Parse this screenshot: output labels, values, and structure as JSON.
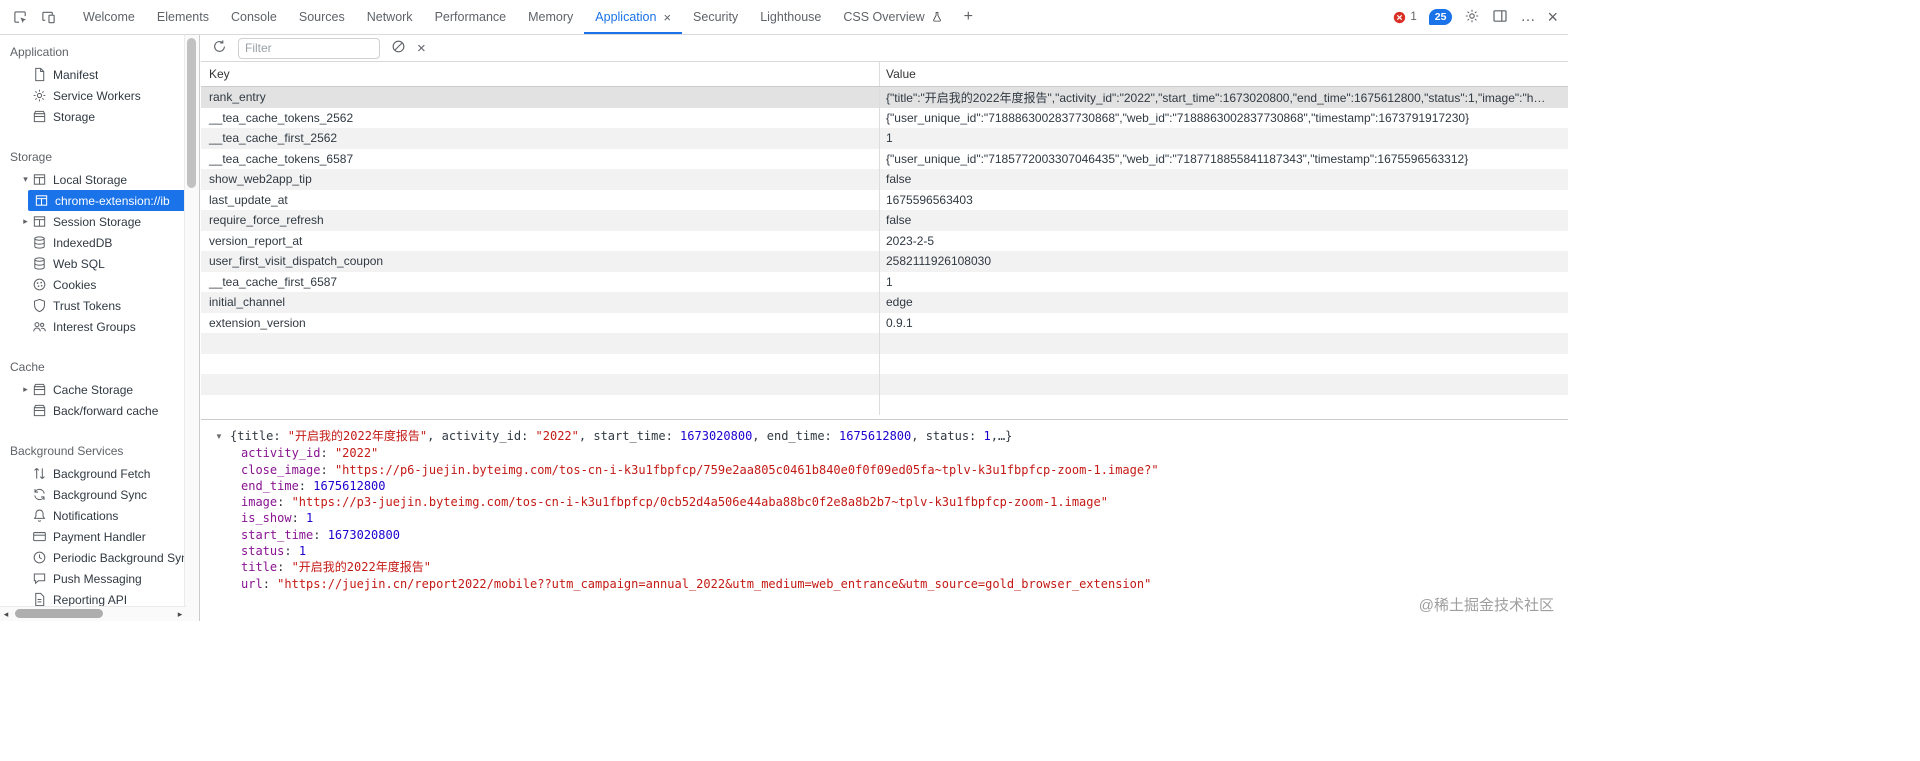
{
  "glyphs": {
    "expanded": "▾",
    "collapsed": "▸",
    "preview_triangle": "▼",
    "dots": "…",
    "close": "×",
    "plus": "+",
    "scroll_left": "◂",
    "scroll_right": "▸"
  },
  "tab_bar": {
    "tabs": [
      {
        "label": "Welcome"
      },
      {
        "label": "Elements"
      },
      {
        "label": "Console"
      },
      {
        "label": "Sources"
      },
      {
        "label": "Network"
      },
      {
        "label": "Performance"
      },
      {
        "label": "Memory"
      },
      {
        "label": "Application",
        "active": true,
        "closable": true
      },
      {
        "label": "Security"
      },
      {
        "label": "Lighthouse"
      },
      {
        "label": "CSS Overview",
        "flagged": true
      }
    ],
    "error_count": "1",
    "issue_count": "25"
  },
  "sidebar": {
    "sections": [
      {
        "title": "Application",
        "items": [
          {
            "label": "Manifest",
            "icon": "manifest-file-icon"
          },
          {
            "label": "Service Workers",
            "icon": "service-worker-icon"
          },
          {
            "label": "Storage",
            "icon": "storage-box-icon"
          }
        ]
      },
      {
        "title": "Storage",
        "items": [
          {
            "label": "Local Storage",
            "icon": "table-icon",
            "expanded": true
          },
          {
            "label": "chrome-extension://ib",
            "icon": "table-icon",
            "selected": true
          },
          {
            "label": "Session Storage",
            "icon": "table-icon",
            "collapsed": true
          },
          {
            "label": "IndexedDB",
            "icon": "database-icon"
          },
          {
            "label": "Web SQL",
            "icon": "database-icon"
          },
          {
            "label": "Cookies",
            "icon": "cookie-icon"
          },
          {
            "label": "Trust Tokens",
            "icon": "shield-icon"
          },
          {
            "label": "Interest Groups",
            "icon": "groups-icon"
          }
        ]
      },
      {
        "title": "Cache",
        "items": [
          {
            "label": "Cache Storage",
            "icon": "storage-box-icon",
            "collapsed": true
          },
          {
            "label": "Back/forward cache",
            "icon": "storage-box-icon"
          }
        ]
      },
      {
        "title": "Background Services",
        "items": [
          {
            "label": "Background Fetch",
            "icon": "fetch-arrows-icon"
          },
          {
            "label": "Background Sync",
            "icon": "sync-icon"
          },
          {
            "label": "Notifications",
            "icon": "bell-icon"
          },
          {
            "label": "Payment Handler",
            "icon": "payment-card-icon"
          },
          {
            "label": "Periodic Background Sync",
            "icon": "clock-icon"
          },
          {
            "label": "Push Messaging",
            "icon": "message-icon"
          },
          {
            "label": "Reporting API",
            "icon": "report-file-icon"
          }
        ]
      }
    ]
  },
  "toolbar": {
    "filter_placeholder": "Filter"
  },
  "table": {
    "columns": [
      "Key",
      "Value"
    ],
    "rows": [
      {
        "key": "rank_entry",
        "value": "{\"title\":\"开启我的2022年度报告\",\"activity_id\":\"2022\",\"start_time\":1673020800,\"end_time\":1675612800,\"status\":1,\"image\":\"h…"
      },
      {
        "key": "__tea_cache_tokens_2562",
        "value": "{\"user_unique_id\":\"7188863002837730868\",\"web_id\":\"7188863002837730868\",\"timestamp\":1673791917230}"
      },
      {
        "key": "__tea_cache_first_2562",
        "value": "1"
      },
      {
        "key": "__tea_cache_tokens_6587",
        "value": "{\"user_unique_id\":\"7185772003307046435\",\"web_id\":\"7187718855841187343\",\"timestamp\":1675596563312}"
      },
      {
        "key": "show_web2app_tip",
        "value": "false"
      },
      {
        "key": "last_update_at",
        "value": "1675596563403"
      },
      {
        "key": "require_force_refresh",
        "value": "false"
      },
      {
        "key": "version_report_at",
        "value": "2023-2-5"
      },
      {
        "key": "user_first_visit_dispatch_coupon",
        "value": "2582111926108030"
      },
      {
        "key": "__tea_cache_first_6587",
        "value": "1"
      },
      {
        "key": "initial_channel",
        "value": "edge"
      },
      {
        "key": "extension_version",
        "value": "0.9.1"
      }
    ]
  },
  "preview": {
    "summary_segments": [
      {
        "t": "{title: ",
        "type": "plain"
      },
      {
        "t": "\"开启我的2022年度报告\"",
        "type": "string"
      },
      {
        "t": ", activity_id: ",
        "type": "plain"
      },
      {
        "t": "\"2022\"",
        "type": "string"
      },
      {
        "t": ", start_time: ",
        "type": "plain"
      },
      {
        "t": "1673020800",
        "type": "number"
      },
      {
        "t": ", end_time: ",
        "type": "plain"
      },
      {
        "t": "1675612800",
        "type": "number"
      },
      {
        "t": ", status: ",
        "type": "plain"
      },
      {
        "t": "1",
        "type": "number"
      },
      {
        "t": ",…}",
        "type": "plain"
      }
    ],
    "props": [
      {
        "key": "activity_id",
        "value": "\"2022\"",
        "type": "string"
      },
      {
        "key": "close_image",
        "value": "\"https://p6-juejin.byteimg.com/tos-cn-i-k3u1fbpfcp/759e2aa805c0461b840e0f0f09ed05fa~tplv-k3u1fbpfcp-zoom-1.image?\"",
        "type": "string"
      },
      {
        "key": "end_time",
        "value": "1675612800",
        "type": "number"
      },
      {
        "key": "image",
        "value": "\"https://p3-juejin.byteimg.com/tos-cn-i-k3u1fbpfcp/0cb52d4a506e44aba88bc0f2e8a8b2b7~tplv-k3u1fbpfcp-zoom-1.image\"",
        "type": "string"
      },
      {
        "key": "is_show",
        "value": "1",
        "type": "number"
      },
      {
        "key": "start_time",
        "value": "1673020800",
        "type": "number"
      },
      {
        "key": "status",
        "value": "1",
        "type": "number"
      },
      {
        "key": "title",
        "value": "\"开启我的2022年度报告\"",
        "type": "string"
      },
      {
        "key": "url",
        "value": "\"https://juejin.cn/report2022/mobile??utm_campaign=annual_2022&utm_medium=web_entrance&utm_source=gold_browser_extension\"",
        "type": "string"
      }
    ]
  },
  "watermark": "@稀土掘金技术社区"
}
